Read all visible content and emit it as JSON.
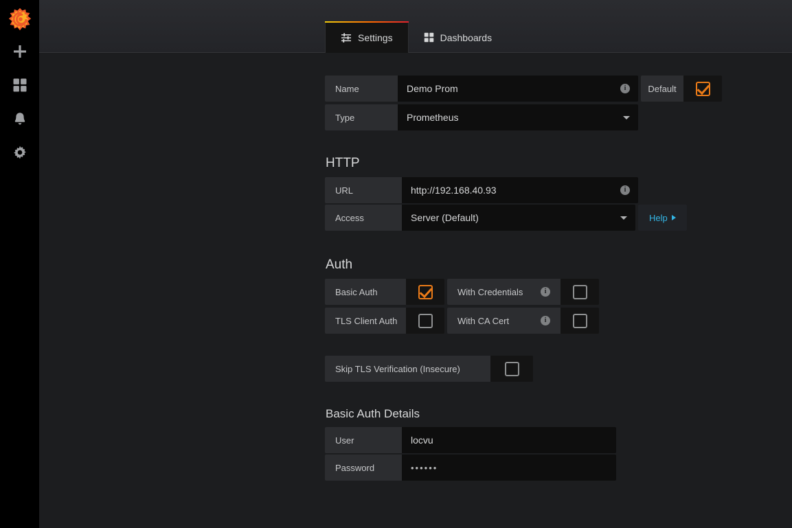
{
  "sidebar": {
    "logo": "grafana-logo",
    "items": [
      {
        "icon": "plus-icon",
        "name": "create"
      },
      {
        "icon": "dashboards-grid-icon",
        "name": "dashboards"
      },
      {
        "icon": "bell-icon",
        "name": "alerting"
      },
      {
        "icon": "gear-icon",
        "name": "configuration"
      }
    ]
  },
  "tabs": [
    {
      "label": "Settings",
      "icon": "sliders-icon",
      "active": true
    },
    {
      "label": "Dashboards",
      "icon": "grid-icon",
      "active": false
    }
  ],
  "general": {
    "name_label": "Name",
    "name_value": "Demo Prom",
    "name_info": "i",
    "default_label": "Default",
    "default_checked": true,
    "type_label": "Type",
    "type_value": "Prometheus"
  },
  "http": {
    "title": "HTTP",
    "url_label": "URL",
    "url_value": "http://192.168.40.93",
    "url_info": "i",
    "access_label": "Access",
    "access_value": "Server (Default)",
    "help_label": "Help"
  },
  "auth": {
    "title": "Auth",
    "basic_auth_label": "Basic Auth",
    "basic_auth_checked": true,
    "with_credentials_label": "With Credentials",
    "with_credentials_info": "i",
    "with_credentials_checked": false,
    "tls_client_auth_label": "TLS Client Auth",
    "tls_client_auth_checked": false,
    "with_ca_cert_label": "With CA Cert",
    "with_ca_cert_info": "i",
    "with_ca_cert_checked": false,
    "skip_tls_label": "Skip TLS Verification (Insecure)",
    "skip_tls_checked": false
  },
  "basic_auth_details": {
    "title": "Basic Auth Details",
    "user_label": "User",
    "user_value": "locvu",
    "password_label": "Password",
    "password_value": "••••••"
  },
  "colors": {
    "accent_orange": "#eb7b18",
    "link_blue": "#33b5e5",
    "page_bg": "#1c1d1f",
    "panel_bg": "#2c2d30",
    "input_bg": "#0e0e0e"
  }
}
